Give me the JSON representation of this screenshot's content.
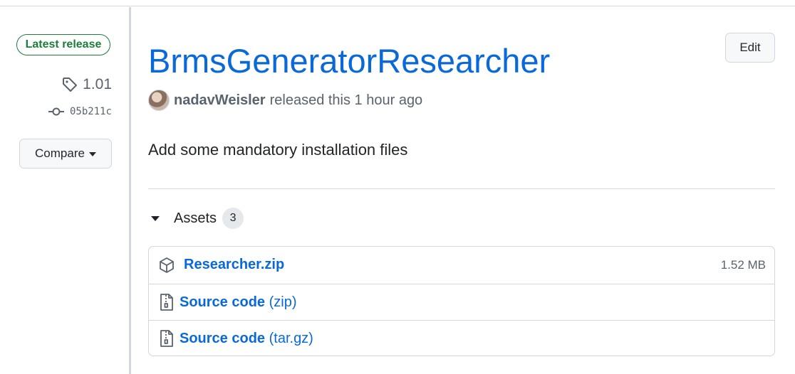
{
  "sidebar": {
    "latest_label": "Latest release",
    "tag": "1.01",
    "commit": "05b211c",
    "compare_label": "Compare"
  },
  "release": {
    "title": "BrmsGeneratorResearcher",
    "edit_label": "Edit",
    "author": "nadavWeisler",
    "released_text": "released this 1 hour ago",
    "description": "Add some mandatory installation files"
  },
  "assets": {
    "heading": "Assets",
    "count": "3",
    "items": [
      {
        "name": "Researcher.zip",
        "suffix": "",
        "size": "1.52 MB",
        "icon": "package-icon"
      },
      {
        "name": "Source code",
        "suffix": "(zip)",
        "size": "",
        "icon": "file-zip-icon"
      },
      {
        "name": "Source code",
        "suffix": "(tar.gz)",
        "size": "",
        "icon": "file-zip-icon"
      }
    ]
  },
  "colors": {
    "accent": "#0969da",
    "success": "#1a7f37",
    "muted": "#59636e",
    "border": "#d0d7de"
  }
}
